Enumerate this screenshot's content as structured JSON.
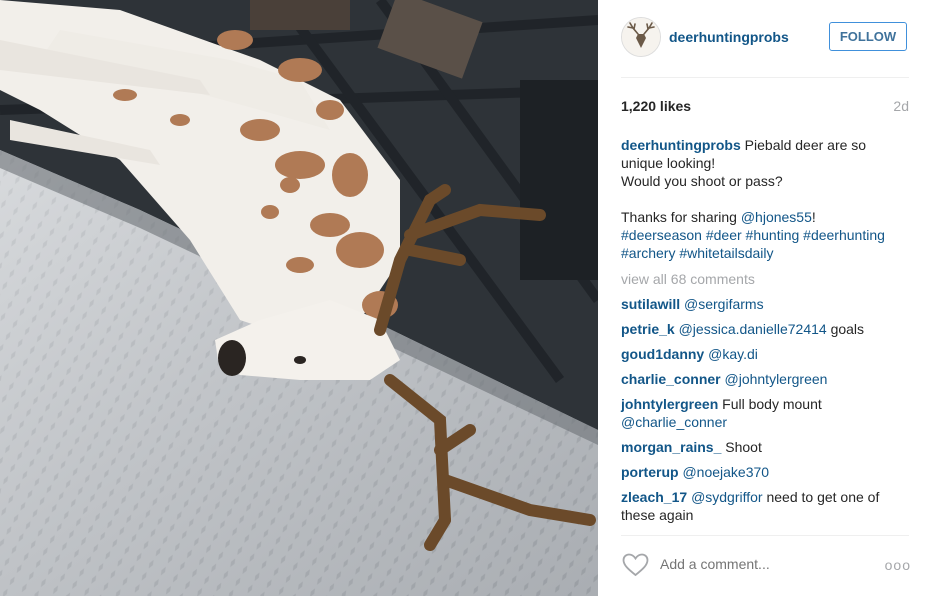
{
  "post": {
    "username": "deerhuntingprobs",
    "follow_label": "FOLLOW",
    "likes": "1,220 likes",
    "time_ago": "2d",
    "caption_line1": "Piebald deer are so unique looking!",
    "caption_line2": "Would you shoot or pass?",
    "thanks_text": "Thanks for sharing ",
    "thanks_mention": "@hjones55",
    "thanks_end": "!",
    "hashtags": [
      "#deerseason",
      "#deer",
      "#hunting",
      "#deerhunting",
      "#archery",
      "#whitetailsdaily"
    ],
    "view_all": "view all 68 comments",
    "add_comment_placeholder": "Add a comment...",
    "more_label": "ooo"
  },
  "comments": [
    {
      "user": "sutilawill",
      "mention": "@sergifarms",
      "text": ""
    },
    {
      "user": "petrie_k",
      "mention": "@jessica.danielle72414",
      "text": " goals"
    },
    {
      "user": "goud1danny",
      "mention": "@kay.di",
      "text": ""
    },
    {
      "user": "charlie_conner",
      "mention": "@johntylergreen",
      "text": ""
    },
    {
      "user": "johntylergreen",
      "mention": "",
      "text": "Full body mount",
      "mention_after": "@charlie_conner"
    },
    {
      "user": "morgan_rains_",
      "mention": "",
      "text": "Shoot"
    },
    {
      "user": "porterup",
      "mention": "@noejake370",
      "text": ""
    },
    {
      "user": "zleach_17",
      "mention": "@sydgriffor",
      "text": " need to get one of these again"
    }
  ],
  "icons": {
    "avatar": "deer-head-icon",
    "heart": "heart-icon",
    "more": "more-options-icon"
  },
  "colors": {
    "link": "#125688",
    "follow_border": "#4090db",
    "muted": "#a5a7aa"
  }
}
